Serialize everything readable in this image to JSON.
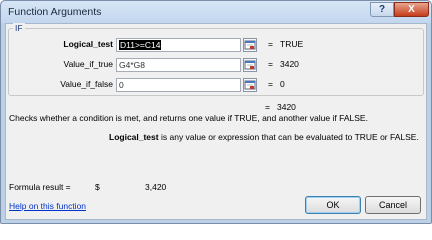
{
  "window": {
    "title": "Function Arguments",
    "help_glyph": "?",
    "close_glyph": "X"
  },
  "group": {
    "title": "IF"
  },
  "args": [
    {
      "label": "Logical_test",
      "value": "D11>=C14",
      "equals": "=",
      "result": "TRUE"
    },
    {
      "label": "Value_if_true",
      "value": "G4*G8",
      "equals": "=",
      "result": "3420"
    },
    {
      "label": "Value_if_false",
      "value": "0",
      "equals": "=",
      "result": "0"
    }
  ],
  "total": {
    "equals": "=",
    "result": "3420"
  },
  "description": "Checks whether a condition is met, and returns one value if TRUE, and another value if FALSE.",
  "arg_description": {
    "name": "Logical_test",
    "text": "is any value or expression that can be evaluated to TRUE or FALSE."
  },
  "formula": {
    "label": "Formula result =",
    "currency": "$",
    "value": "3,420"
  },
  "help_link": "Help on this function",
  "buttons": {
    "ok": "OK",
    "cancel": "Cancel"
  },
  "colors": {
    "accent": "#3c7fb1",
    "link": "#0033cc",
    "close": "#c43d1a"
  },
  "icons": {
    "ref_button": "collapse-dialog-icon"
  }
}
